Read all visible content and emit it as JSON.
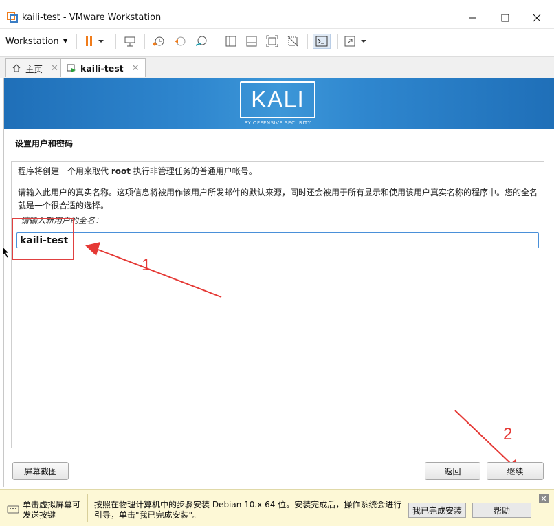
{
  "window": {
    "title": "kaili-test - VMware Workstation"
  },
  "toolbar": {
    "workstation_label": "Workstation"
  },
  "tabs": [
    {
      "label": "主页"
    },
    {
      "label": "kaili-test"
    }
  ],
  "installer": {
    "brand": "KALI",
    "brand_sub": "BY OFFENSIVE SECURITY",
    "section_title": "设置用户和密码",
    "para1_prefix": "程序将创建一个用来取代 ",
    "para1_bold": "root",
    "para1_suffix": " 执行非管理任务的普通用户帐号。",
    "para2": "请输入此用户的真实名称。这项信息将被用作该用户所发邮件的默认来源，同时还会被用于所有显示和使用该用户真实名称的程序中。您的全名就是一个很合适的选择。",
    "prompt": "请输入新用户的全名：",
    "fullname_value": "kaili-test",
    "screenshot_button": "屏幕截图",
    "back_button": "返回",
    "continue_button": "继续"
  },
  "annotations": {
    "marker1": "1",
    "marker2": "2"
  },
  "hint": {
    "left_text": "单击虚拟屏幕可发送按键",
    "main_text": "按照在物理计算机中的步骤安装 Debian 10.x 64 位。安装完成后，操作系统会进行引导，单击\"我已完成安装\"。",
    "done_button": "我已完成安装",
    "help_button": "帮助"
  },
  "colors": {
    "accent": "#2f87cf",
    "annotation": "#e53935",
    "hint_bg": "#fdf8d6",
    "pause": "#f07c1b"
  }
}
